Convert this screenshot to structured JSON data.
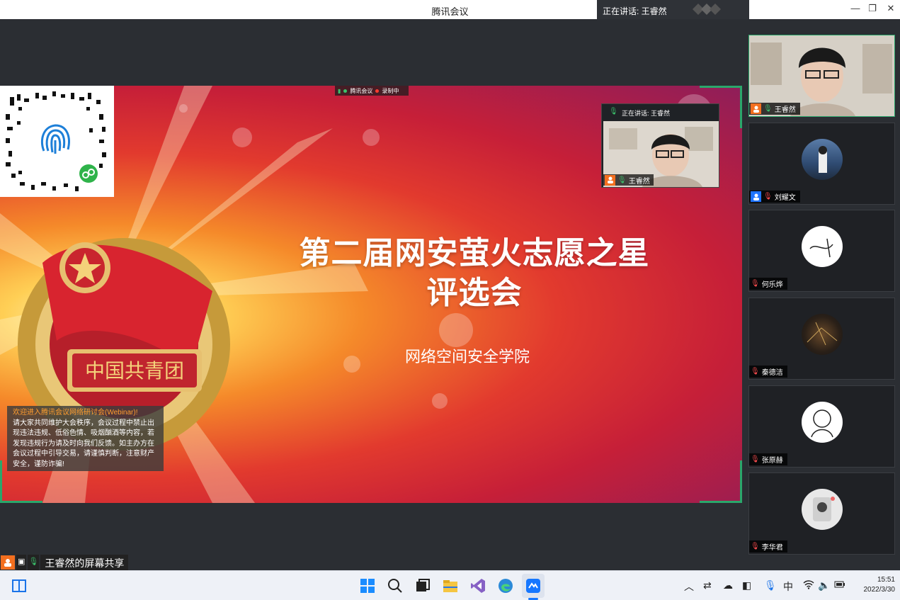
{
  "window": {
    "title": "腾讯会议",
    "speaking": "正在讲话: 王睿然"
  },
  "window_controls": {
    "minimize": "—",
    "restore": "❐",
    "close": "✕"
  },
  "slide": {
    "title_line1": "第二届网安萤火志愿之星",
    "title_line2": "评选会",
    "subtitle": "网络空间安全学院",
    "emblem_text": "中国共青团"
  },
  "rec_chip": {
    "app": "腾讯会议",
    "status": "录制中"
  },
  "pip": {
    "speaking": "正在讲话: 王睿然",
    "name": "王睿然"
  },
  "notice": {
    "headline": "欢迎进入腾讯会议网络研讨会(Webinar)!",
    "body": "请大家共同维护大会秩序，会议过程中禁止出现违法违规、低俗色情、吸烟酗酒等内容，若发现违规行为请及时向我们反馈。如主办方在会议过程中引导交易，请谨慎判断，注意财产安全，谨防诈骗!"
  },
  "share_bar": {
    "label": "王睿然的屏幕共享"
  },
  "participants": [
    {
      "name": "王睿然",
      "active": true,
      "video": true,
      "badge": "orange"
    },
    {
      "name": "刘耀文",
      "active": false,
      "video": false,
      "badge": "blue"
    },
    {
      "name": "何乐烨",
      "active": false,
      "video": false,
      "badge": ""
    },
    {
      "name": "秦德洁",
      "active": false,
      "video": false,
      "badge": ""
    },
    {
      "name": "张原赫",
      "active": false,
      "video": false,
      "badge": ""
    },
    {
      "name": "李华君",
      "active": false,
      "video": false,
      "badge": ""
    }
  ],
  "taskbar": {
    "ime": "中",
    "time": "15:51",
    "date": "2022/3/30"
  },
  "colors": {
    "accent_green": "#2aa76b",
    "orange": "#f36f1f",
    "blue": "#1f74ff"
  }
}
